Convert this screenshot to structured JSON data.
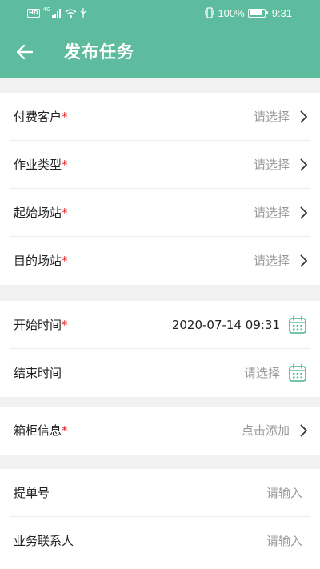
{
  "status_bar": {
    "battery": "100%",
    "time": "9:31",
    "hd": "HD",
    "signal_tag": "4G"
  },
  "header": {
    "title": "发布任务"
  },
  "required_mark": "*",
  "section1": [
    {
      "label": "付费客户",
      "value": "请选择"
    },
    {
      "label": "作业类型",
      "value": "请选择"
    },
    {
      "label": "起始场站",
      "value": "请选择"
    },
    {
      "label": "目的场站",
      "value": "请选择"
    }
  ],
  "section2": [
    {
      "label": "开始时间",
      "value": "2020-07-14 09:31"
    },
    {
      "label": "结束时间",
      "value": "请选择"
    }
  ],
  "section3": [
    {
      "label": "箱柜信息",
      "value": "点击添加"
    }
  ],
  "section4": [
    {
      "label": "提单号",
      "placeholder": "请输入"
    },
    {
      "label": "业务联系人",
      "placeholder": "请输入"
    }
  ],
  "colors": {
    "primary": "#5ebc9e",
    "required": "#e02020",
    "placeholder": "#9a9a9a"
  },
  "icons": [
    "back-arrow-icon",
    "chevron-right-icon",
    "calendar-icon",
    "battery-icon",
    "wifi-icon",
    "signal-icon",
    "usb-icon",
    "vibrate-icon"
  ]
}
